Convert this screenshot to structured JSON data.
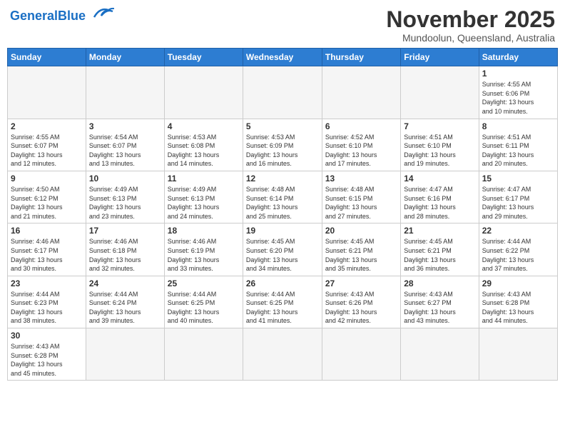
{
  "header": {
    "logo_general": "General",
    "logo_blue": "Blue",
    "month_title": "November 2025",
    "location": "Mundoolun, Queensland, Australia"
  },
  "days_of_week": [
    "Sunday",
    "Monday",
    "Tuesday",
    "Wednesday",
    "Thursday",
    "Friday",
    "Saturday"
  ],
  "weeks": [
    [
      {
        "day": "",
        "info": ""
      },
      {
        "day": "",
        "info": ""
      },
      {
        "day": "",
        "info": ""
      },
      {
        "day": "",
        "info": ""
      },
      {
        "day": "",
        "info": ""
      },
      {
        "day": "",
        "info": ""
      },
      {
        "day": "1",
        "info": "Sunrise: 4:55 AM\nSunset: 6:06 PM\nDaylight: 13 hours\nand 10 minutes."
      }
    ],
    [
      {
        "day": "2",
        "info": "Sunrise: 4:55 AM\nSunset: 6:07 PM\nDaylight: 13 hours\nand 12 minutes."
      },
      {
        "day": "3",
        "info": "Sunrise: 4:54 AM\nSunset: 6:07 PM\nDaylight: 13 hours\nand 13 minutes."
      },
      {
        "day": "4",
        "info": "Sunrise: 4:53 AM\nSunset: 6:08 PM\nDaylight: 13 hours\nand 14 minutes."
      },
      {
        "day": "5",
        "info": "Sunrise: 4:53 AM\nSunset: 6:09 PM\nDaylight: 13 hours\nand 16 minutes."
      },
      {
        "day": "6",
        "info": "Sunrise: 4:52 AM\nSunset: 6:10 PM\nDaylight: 13 hours\nand 17 minutes."
      },
      {
        "day": "7",
        "info": "Sunrise: 4:51 AM\nSunset: 6:10 PM\nDaylight: 13 hours\nand 19 minutes."
      },
      {
        "day": "8",
        "info": "Sunrise: 4:51 AM\nSunset: 6:11 PM\nDaylight: 13 hours\nand 20 minutes."
      }
    ],
    [
      {
        "day": "9",
        "info": "Sunrise: 4:50 AM\nSunset: 6:12 PM\nDaylight: 13 hours\nand 21 minutes."
      },
      {
        "day": "10",
        "info": "Sunrise: 4:49 AM\nSunset: 6:13 PM\nDaylight: 13 hours\nand 23 minutes."
      },
      {
        "day": "11",
        "info": "Sunrise: 4:49 AM\nSunset: 6:13 PM\nDaylight: 13 hours\nand 24 minutes."
      },
      {
        "day": "12",
        "info": "Sunrise: 4:48 AM\nSunset: 6:14 PM\nDaylight: 13 hours\nand 25 minutes."
      },
      {
        "day": "13",
        "info": "Sunrise: 4:48 AM\nSunset: 6:15 PM\nDaylight: 13 hours\nand 27 minutes."
      },
      {
        "day": "14",
        "info": "Sunrise: 4:47 AM\nSunset: 6:16 PM\nDaylight: 13 hours\nand 28 minutes."
      },
      {
        "day": "15",
        "info": "Sunrise: 4:47 AM\nSunset: 6:17 PM\nDaylight: 13 hours\nand 29 minutes."
      }
    ],
    [
      {
        "day": "16",
        "info": "Sunrise: 4:46 AM\nSunset: 6:17 PM\nDaylight: 13 hours\nand 30 minutes."
      },
      {
        "day": "17",
        "info": "Sunrise: 4:46 AM\nSunset: 6:18 PM\nDaylight: 13 hours\nand 32 minutes."
      },
      {
        "day": "18",
        "info": "Sunrise: 4:46 AM\nSunset: 6:19 PM\nDaylight: 13 hours\nand 33 minutes."
      },
      {
        "day": "19",
        "info": "Sunrise: 4:45 AM\nSunset: 6:20 PM\nDaylight: 13 hours\nand 34 minutes."
      },
      {
        "day": "20",
        "info": "Sunrise: 4:45 AM\nSunset: 6:21 PM\nDaylight: 13 hours\nand 35 minutes."
      },
      {
        "day": "21",
        "info": "Sunrise: 4:45 AM\nSunset: 6:21 PM\nDaylight: 13 hours\nand 36 minutes."
      },
      {
        "day": "22",
        "info": "Sunrise: 4:44 AM\nSunset: 6:22 PM\nDaylight: 13 hours\nand 37 minutes."
      }
    ],
    [
      {
        "day": "23",
        "info": "Sunrise: 4:44 AM\nSunset: 6:23 PM\nDaylight: 13 hours\nand 38 minutes."
      },
      {
        "day": "24",
        "info": "Sunrise: 4:44 AM\nSunset: 6:24 PM\nDaylight: 13 hours\nand 39 minutes."
      },
      {
        "day": "25",
        "info": "Sunrise: 4:44 AM\nSunset: 6:25 PM\nDaylight: 13 hours\nand 40 minutes."
      },
      {
        "day": "26",
        "info": "Sunrise: 4:44 AM\nSunset: 6:25 PM\nDaylight: 13 hours\nand 41 minutes."
      },
      {
        "day": "27",
        "info": "Sunrise: 4:43 AM\nSunset: 6:26 PM\nDaylight: 13 hours\nand 42 minutes."
      },
      {
        "day": "28",
        "info": "Sunrise: 4:43 AM\nSunset: 6:27 PM\nDaylight: 13 hours\nand 43 minutes."
      },
      {
        "day": "29",
        "info": "Sunrise: 4:43 AM\nSunset: 6:28 PM\nDaylight: 13 hours\nand 44 minutes."
      }
    ],
    [
      {
        "day": "30",
        "info": "Sunrise: 4:43 AM\nSunset: 6:28 PM\nDaylight: 13 hours\nand 45 minutes."
      },
      {
        "day": "",
        "info": ""
      },
      {
        "day": "",
        "info": ""
      },
      {
        "day": "",
        "info": ""
      },
      {
        "day": "",
        "info": ""
      },
      {
        "day": "",
        "info": ""
      },
      {
        "day": "",
        "info": ""
      }
    ]
  ]
}
